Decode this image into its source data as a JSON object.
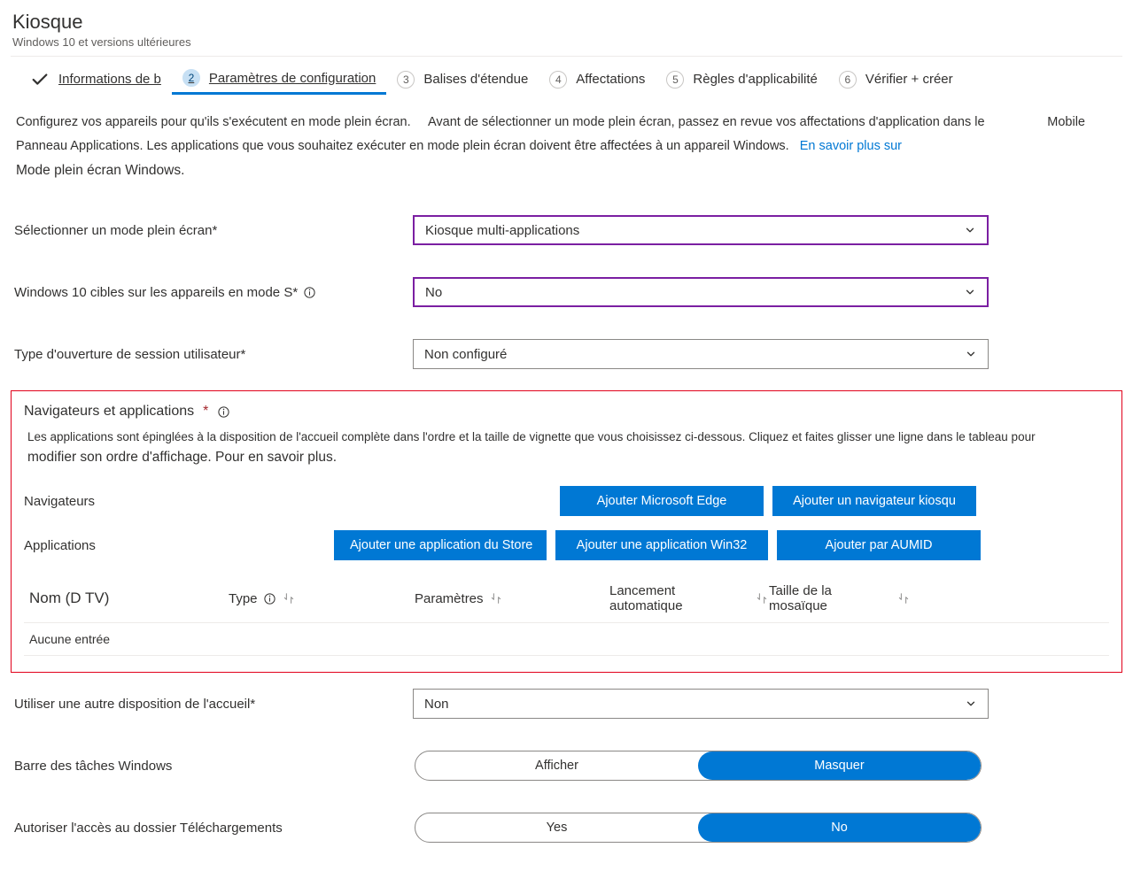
{
  "header": {
    "title": "Kiosque",
    "subtitle": "Windows 10 et versions ultérieures"
  },
  "steps": {
    "s1": "Informations de b",
    "s2": "Paramètres de configuration",
    "s3": "Balises d'étendue",
    "s4": "Affectations",
    "s5": "Règles d'applicabilité",
    "s6": "Vérifier + créer",
    "n2": "2",
    "n3": "3",
    "n4": "4",
    "n5": "5",
    "n6": "6"
  },
  "intro": {
    "line_a": "Configurez vos appareils pour qu'ils s'exécutent en mode plein écran.",
    "line_b": "Avant de sélectionner un mode plein écran, passez en revue vos affectations d'application dans le",
    "mobile": "Mobile",
    "line_c": "Panneau Applications. Les applications que vous souhaitez exécuter en mode plein écran doivent être affectées à un appareil Windows.",
    "learn_more": "En savoir plus sur",
    "line_d": "Mode plein écran Windows."
  },
  "form": {
    "select_mode_label": "Sélectionner un mode plein écran*",
    "select_mode_value": "Kiosque multi-applications",
    "smode_label": "Windows 10 cibles sur les appareils en mode S*",
    "smode_value": "No",
    "logon_label": "Type d'ouverture de session utilisateur*",
    "logon_value": "Non configuré"
  },
  "section": {
    "title": "Navigateurs et applications",
    "help_a": "Les applications sont épinglées à la disposition de l'accueil complète dans l'ordre et la taille de vignette que vous choisissez ci-dessous. Cliquez et faites glisser une ligne dans le tableau pour",
    "help_b": "modifier son ordre d'affichage. Pour en savoir plus."
  },
  "rows": {
    "browsers_label": "Navigateurs",
    "apps_label": "Applications",
    "btn_edge": "Ajouter Microsoft Edge",
    "btn_kiosk": "Ajouter un navigateur kiosqu",
    "btn_store": "Ajouter une application du Store",
    "btn_win32": "Ajouter une application Win32",
    "btn_aumid": "Ajouter par AUMID"
  },
  "table": {
    "col1": "Nom (D TV)",
    "col2": "Type",
    "col3": "Paramètres",
    "col4": "Lancement automatique",
    "col5": "Taille de la mosaïque",
    "empty": "Aucune entrée"
  },
  "lower": {
    "alt_start_label": "Utiliser une autre disposition de l'accueil*",
    "alt_start_value": "Non",
    "taskbar_label": "Barre des tâches Windows",
    "taskbar_show": "Afficher",
    "taskbar_hide": "Masquer",
    "downloads_label": "Autoriser l'accès au dossier Téléchargements",
    "downloads_yes": "Yes",
    "downloads_no": "No"
  }
}
